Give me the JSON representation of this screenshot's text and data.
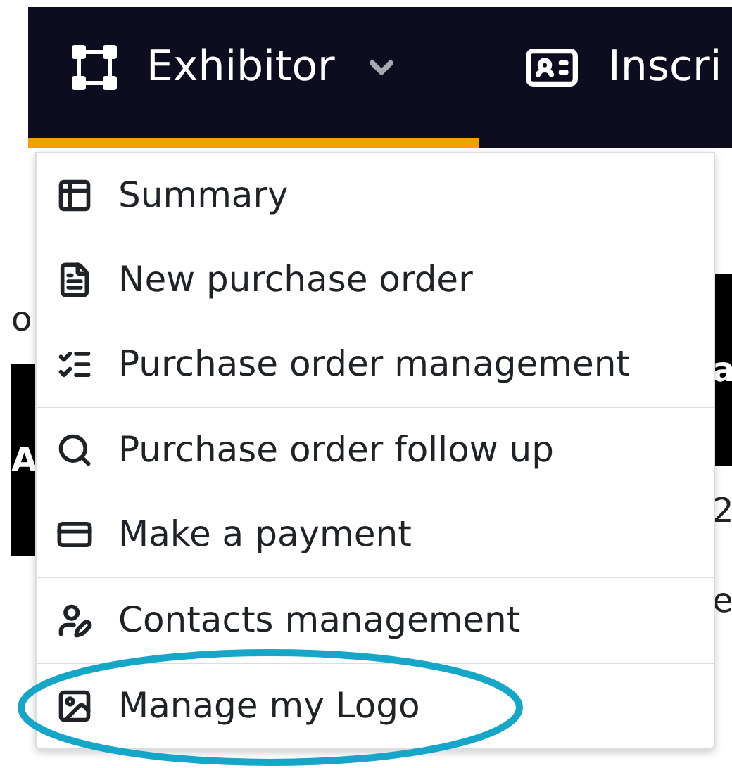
{
  "nav": {
    "tabs": [
      {
        "label": "Exhibitor",
        "kind": "vector",
        "selected": true,
        "expanded": true
      },
      {
        "label": "Inscri",
        "kind": "card",
        "selected": false,
        "expanded": false
      }
    ]
  },
  "menu": {
    "groups": [
      [
        {
          "label": "Summary",
          "kind": "table",
          "highlighted": false
        },
        {
          "label": "New purchase order",
          "kind": "file",
          "highlighted": false
        },
        {
          "label": "Purchase order management",
          "kind": "checklist",
          "highlighted": false
        }
      ],
      [
        {
          "label": "Purchase order follow up",
          "kind": "search",
          "highlighted": false
        },
        {
          "label": "Make a payment",
          "kind": "payment",
          "highlighted": false
        }
      ],
      [
        {
          "label": "Contacts management",
          "kind": "contacts",
          "highlighted": false
        }
      ],
      [
        {
          "label": "Manage my Logo",
          "kind": "logo",
          "highlighted": true
        }
      ]
    ]
  },
  "background": {
    "left": [
      {
        "text": "o",
        "dark_band": false
      },
      {
        "text": "A",
        "dark_band": true
      }
    ],
    "right": [
      {
        "text": "a",
        "dark_band": true
      },
      {
        "text": "2",
        "dark_band": false
      },
      {
        "text": "e",
        "dark_band": false
      }
    ]
  }
}
